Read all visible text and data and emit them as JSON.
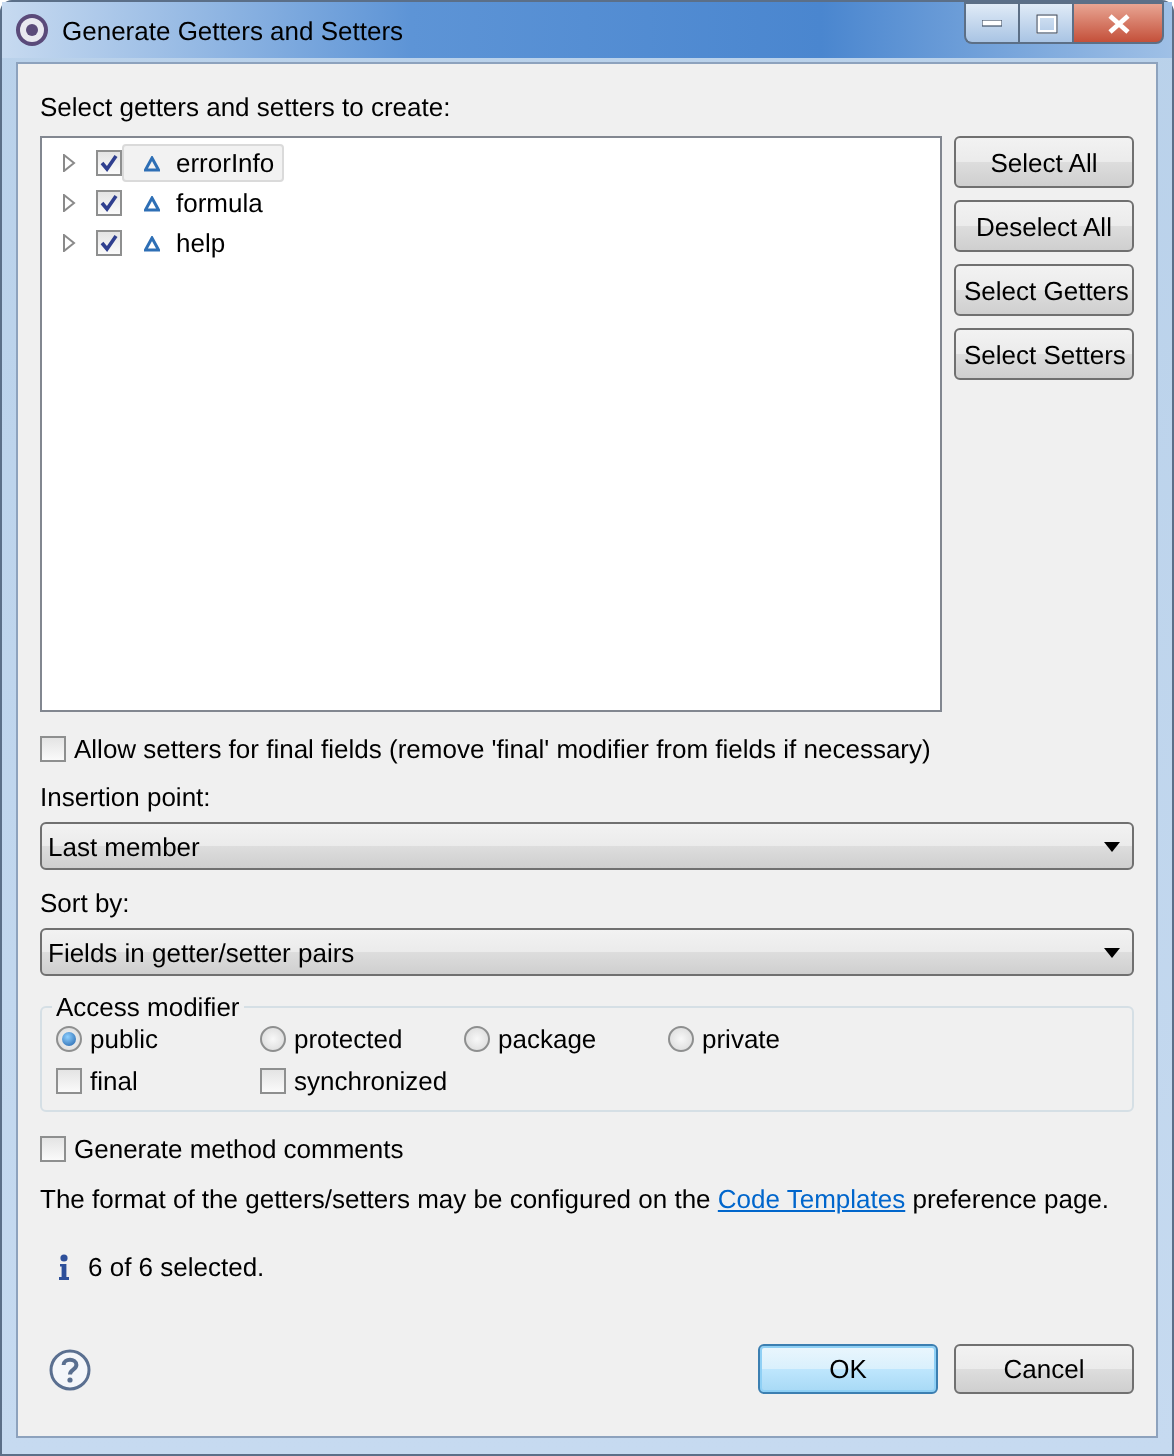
{
  "window": {
    "title": "Generate Getters and Setters"
  },
  "prompt": "Select getters and setters to create:",
  "fields": [
    {
      "name": "errorInfo",
      "checked": true,
      "expanded": false,
      "selected": true
    },
    {
      "name": "formula",
      "checked": true,
      "expanded": false,
      "selected": false
    },
    {
      "name": "help",
      "checked": true,
      "expanded": false,
      "selected": false
    }
  ],
  "side_buttons": [
    "Select All",
    "Deselect All",
    "Select Getters",
    "Select Setters"
  ],
  "allow_final": {
    "label": "Allow setters for final fields (remove 'final' modifier from fields if necessary)",
    "checked": false
  },
  "insertion_point": {
    "label": "Insertion point:",
    "value": "Last member"
  },
  "sort_by": {
    "label": "Sort by:",
    "value": "Fields in getter/setter pairs"
  },
  "access_modifier": {
    "title": "Access modifier",
    "options": [
      {
        "label": "public",
        "selected": true
      },
      {
        "label": "protected",
        "selected": false
      },
      {
        "label": "package",
        "selected": false
      },
      {
        "label": "private",
        "selected": false
      }
    ],
    "modifiers": [
      {
        "label": "final",
        "checked": false
      },
      {
        "label": "synchronized",
        "checked": false
      }
    ]
  },
  "method_comments": {
    "label": "Generate method comments",
    "checked": false
  },
  "info": {
    "before": "The format of the getters/setters may be configured on the ",
    "link": "Code Templates",
    "after": " preference page."
  },
  "status": "6 of 6 selected.",
  "buttons": [
    {
      "label": "OK",
      "default": true
    },
    {
      "label": "Cancel",
      "default": false
    }
  ]
}
